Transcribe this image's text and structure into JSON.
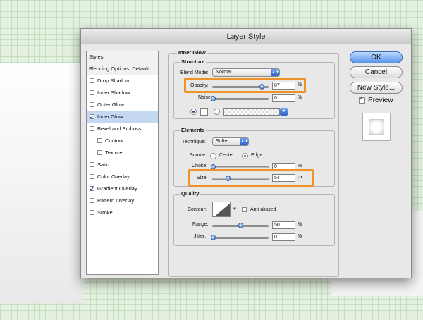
{
  "dialog": {
    "title": "Layer Style"
  },
  "styles_list": {
    "header": "Styles",
    "blending": "Blending Options: Default",
    "items": [
      {
        "label": "Drop Shadow",
        "checked": false
      },
      {
        "label": "Inner Shadow",
        "checked": false
      },
      {
        "label": "Outer Glow",
        "checked": false
      },
      {
        "label": "Inner Glow",
        "checked": true
      },
      {
        "label": "Bevel and Emboss",
        "checked": false
      },
      {
        "label": "Contour",
        "checked": false
      },
      {
        "label": "Texture",
        "checked": false
      },
      {
        "label": "Satin",
        "checked": false
      },
      {
        "label": "Color Overlay",
        "checked": false
      },
      {
        "label": "Gradient Overlay",
        "checked": true
      },
      {
        "label": "Pattern Overlay",
        "checked": false
      },
      {
        "label": "Stroke",
        "checked": false
      }
    ]
  },
  "inner_glow": {
    "title": "Inner Glow",
    "structure": {
      "title": "Structure",
      "blend_mode_label": "Blend Mode:",
      "blend_mode_value": "Normal",
      "opacity_label": "Opacity:",
      "opacity_value": "87",
      "opacity_unit": "%",
      "noise_label": "Noise:",
      "noise_value": "0",
      "noise_unit": "%"
    },
    "elements": {
      "title": "Elements",
      "technique_label": "Technique:",
      "technique_value": "Softer",
      "source_label": "Source:",
      "source_center": "Center",
      "source_edge": "Edge",
      "choke_label": "Choke:",
      "choke_value": "0",
      "choke_unit": "%",
      "size_label": "Size:",
      "size_value": "54",
      "size_unit": "px"
    },
    "quality": {
      "title": "Quality",
      "contour_label": "Contour:",
      "anti_aliased_label": "Anti-aliased",
      "range_label": "Range:",
      "range_value": "50",
      "range_unit": "%",
      "jitter_label": "Jitter:",
      "jitter_value": "0",
      "jitter_unit": "%"
    }
  },
  "buttons": {
    "ok": "OK",
    "cancel": "Cancel",
    "new_style": "New Style...",
    "preview_label": "Preview"
  },
  "colors": {
    "highlight": "#f0922a",
    "accent": "#5a95e8",
    "selected_row": "#c5d8f2"
  }
}
